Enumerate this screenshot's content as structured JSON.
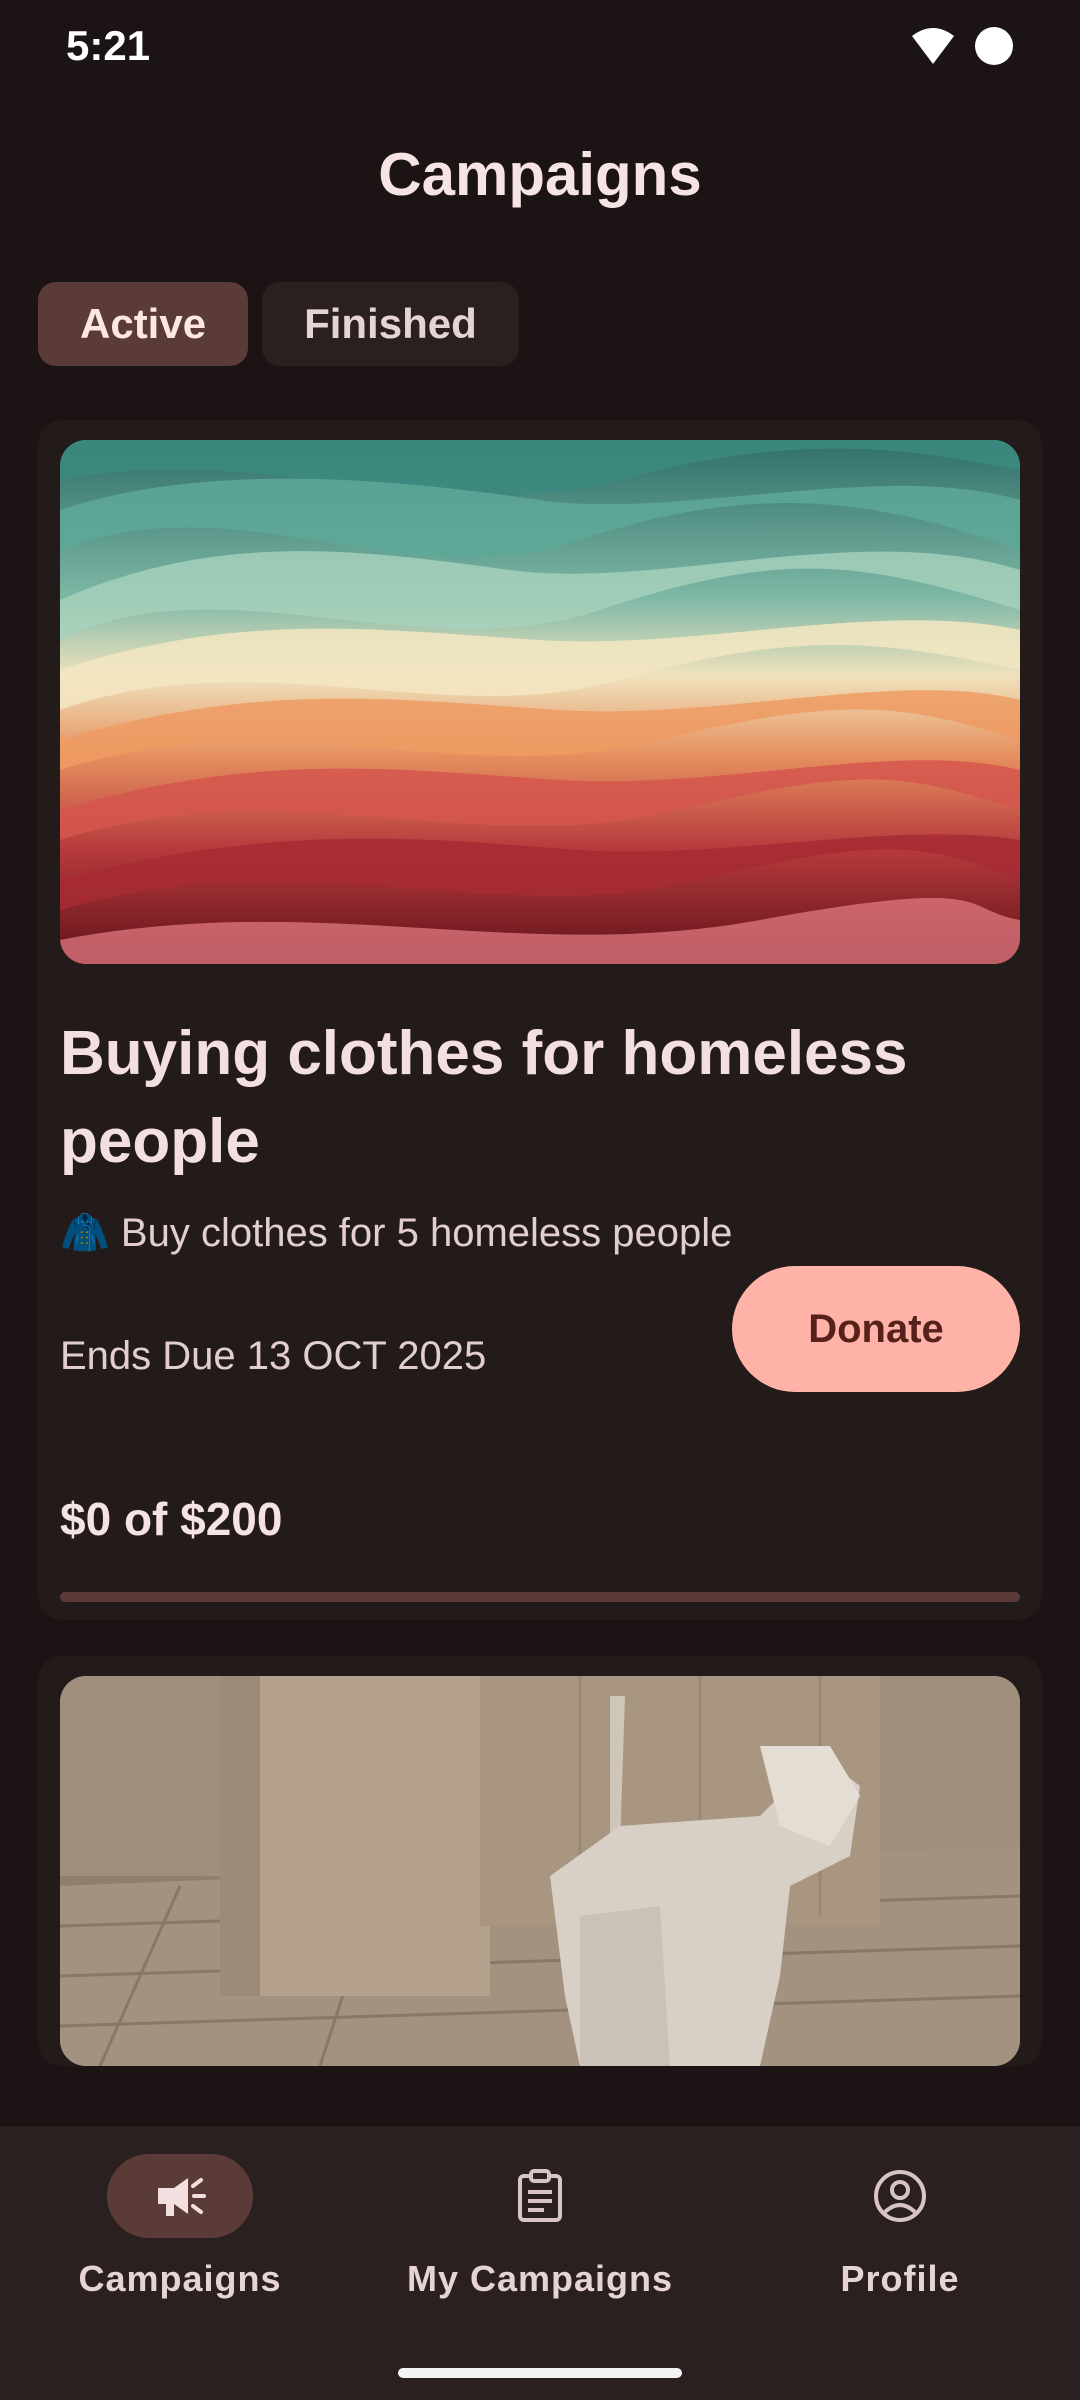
{
  "status_bar": {
    "time": "5:21"
  },
  "page": {
    "title": "Campaigns"
  },
  "tabs": [
    {
      "label": "Active"
    },
    {
      "label": "Finished"
    }
  ],
  "campaigns": [
    {
      "title": "Buying clothes for homeless people",
      "description": "🧥 Buy clothes for 5 homeless people",
      "ends": "Ends Due 13 OCT 2025",
      "donate_label": "Donate",
      "raised_text": "$0 of $200",
      "progress": 0
    }
  ],
  "bottom_nav": [
    {
      "label": "Campaigns",
      "icon": "megaphone-icon"
    },
    {
      "label": "My Campaigns",
      "icon": "clipboard-icon"
    },
    {
      "label": "Profile",
      "icon": "profile-icon"
    }
  ],
  "colors": {
    "background": "#1c1414",
    "accent": "#ffb3a8",
    "surface": "#231a1a"
  }
}
